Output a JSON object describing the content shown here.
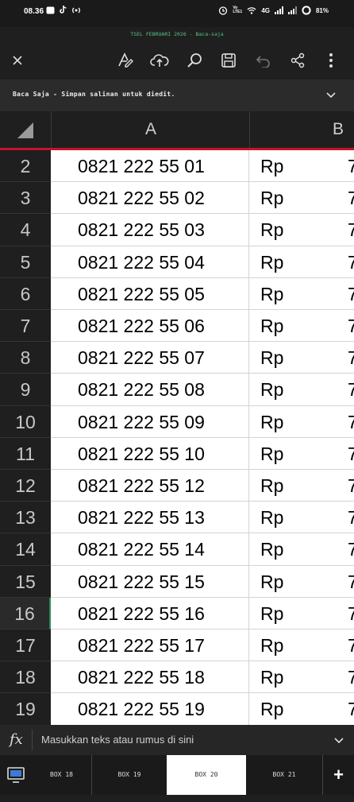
{
  "status_bar": {
    "time": "08.36",
    "battery": "81%",
    "net_label": "Vo LTE1",
    "signal_label": "4G"
  },
  "document": {
    "title": "TSEL FEBRUARI 2026 - Baca-saja"
  },
  "toolbar": {
    "icons": [
      "close-icon",
      "draw-icon",
      "cloud-upload-icon",
      "search-icon",
      "save-icon",
      "undo-icon",
      "share-icon",
      "more-icon"
    ]
  },
  "banner": {
    "text": "Baca Saja - Simpan salinan untuk diedit."
  },
  "columns": [
    "A",
    "B"
  ],
  "rows": [
    {
      "num": "2",
      "a": "0821 222 55 01",
      "b": "Rp",
      "c": "7"
    },
    {
      "num": "3",
      "a": "0821 222 55 02",
      "b": "Rp",
      "c": "7"
    },
    {
      "num": "4",
      "a": "0821 222 55 03",
      "b": "Rp",
      "c": "7"
    },
    {
      "num": "5",
      "a": "0821 222 55 04",
      "b": "Rp",
      "c": "7"
    },
    {
      "num": "6",
      "a": "0821 222 55 05",
      "b": "Rp",
      "c": "7"
    },
    {
      "num": "7",
      "a": "0821 222 55 06",
      "b": "Rp",
      "c": "7"
    },
    {
      "num": "8",
      "a": "0821 222 55 07",
      "b": "Rp",
      "c": "7"
    },
    {
      "num": "9",
      "a": "0821 222 55 08",
      "b": "Rp",
      "c": "7"
    },
    {
      "num": "10",
      "a": "0821 222 55 09",
      "b": "Rp",
      "c": "7"
    },
    {
      "num": "11",
      "a": "0821 222 55 10",
      "b": "Rp",
      "c": "7"
    },
    {
      "num": "12",
      "a": "0821 222 55 12",
      "b": "Rp",
      "c": "7"
    },
    {
      "num": "13",
      "a": "0821 222 55 13",
      "b": "Rp",
      "c": "7"
    },
    {
      "num": "14",
      "a": "0821 222 55 14",
      "b": "Rp",
      "c": "7"
    },
    {
      "num": "15",
      "a": "0821 222 55 15",
      "b": "Rp",
      "c": "7"
    },
    {
      "num": "16",
      "a": "0821 222 55 16",
      "b": "Rp",
      "c": "7"
    },
    {
      "num": "17",
      "a": "0821 222 55 17",
      "b": "Rp",
      "c": "7"
    },
    {
      "num": "18",
      "a": "0821 222 55 18",
      "b": "Rp",
      "c": "7"
    },
    {
      "num": "19",
      "a": "0821 222 55 19",
      "b": "Rp",
      "c": "7"
    }
  ],
  "selected_row": "16",
  "formula_bar": {
    "fx": "fx",
    "placeholder": "Masukkan teks atau rumus di sini"
  },
  "sheet_tabs": [
    "BOX 18",
    "BOX 19",
    "BOX 20",
    "BOX 21"
  ],
  "active_sheet": "BOX 20",
  "add_sheet": "+",
  "colors": {
    "accent_red": "#c8102e",
    "title_green": "#58c08a",
    "dark_bg": "#1f1f1f"
  }
}
